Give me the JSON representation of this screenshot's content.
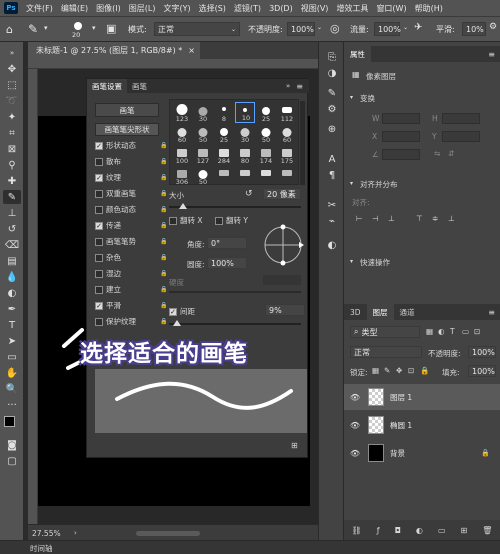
{
  "menubar": {
    "items": [
      "文件(F)",
      "编辑(E)",
      "图像(I)",
      "图层(L)",
      "文字(Y)",
      "选择(S)",
      "滤镜(T)",
      "3D(D)",
      "视图(V)",
      "增效工具",
      "窗口(W)",
      "帮助(H)"
    ],
    "logo": "Ps"
  },
  "options": {
    "brush_size": "20",
    "mode_label": "模式:",
    "mode_value": "正常",
    "opacity_label": "不透明度:",
    "opacity_value": "100%",
    "flow_label": "流量:",
    "flow_value": "100%",
    "smooth_label": "平滑:",
    "smooth_value": "10%"
  },
  "document": {
    "tab_title": "未标题-1 @ 27.5% (图层 1, RGB/8#) *",
    "zoom": "27.55%"
  },
  "brush_panel": {
    "tabs": [
      "画笔设置",
      "画笔"
    ],
    "brush_button": "画笔",
    "tip_shape": "画笔笔尖形状",
    "options": [
      {
        "label": "形状动态",
        "checked": true
      },
      {
        "label": "散布",
        "checked": false
      },
      {
        "label": "纹理",
        "checked": true
      },
      {
        "label": "双重画笔",
        "checked": false
      },
      {
        "label": "颜色动态",
        "checked": false
      },
      {
        "label": "传递",
        "checked": true
      },
      {
        "label": "画笔笔势",
        "checked": false
      },
      {
        "label": "杂色",
        "checked": false
      },
      {
        "label": "湿边",
        "checked": false
      },
      {
        "label": "建立",
        "checked": false
      },
      {
        "label": "平滑",
        "checked": true
      },
      {
        "label": "保护纹理",
        "checked": false
      }
    ],
    "presets": [
      "123",
      "30",
      "8",
      "10",
      "25",
      "112",
      "60",
      "50",
      "25",
      "30",
      "50",
      "60",
      "100",
      "127",
      "284",
      "80",
      "174",
      "175",
      "306",
      "50",
      "",
      "",
      "",
      ""
    ],
    "size_label": "大小",
    "size_value": "20 像素",
    "flip_x": "翻转 X",
    "flip_y": "翻转 Y",
    "angle_label": "角度:",
    "angle_value": "0°",
    "roundness_label": "圆度:",
    "roundness_value": "100%",
    "hardness_label": "硬度",
    "spacing_label": "间距",
    "spacing_value": "9%"
  },
  "right_panel": {
    "properties_tab": "属性",
    "pixel_layer": "像素图层",
    "transform_label": "变换",
    "w_label": "W",
    "h_label": "H",
    "x_label": "X",
    "y_label": "Y",
    "align_label": "对齐并分布",
    "align_sub": "对齐:",
    "quick_actions": "快速操作",
    "layer_tabs": [
      "3D",
      "图层",
      "通道"
    ],
    "filter_kind": "类型",
    "blend_mode": "正常",
    "opacity_label": "不透明度:",
    "opacity_value": "100%",
    "lock_label": "锁定:",
    "fill_label": "填充:",
    "fill_value": "100%",
    "layers": [
      {
        "name": "图层 1",
        "selected": true
      },
      {
        "name": "椭圆 1",
        "selected": false
      },
      {
        "name": "背景",
        "selected": false
      }
    ]
  },
  "timeline_label": "时间轴",
  "caption": "选择适合的画笔"
}
